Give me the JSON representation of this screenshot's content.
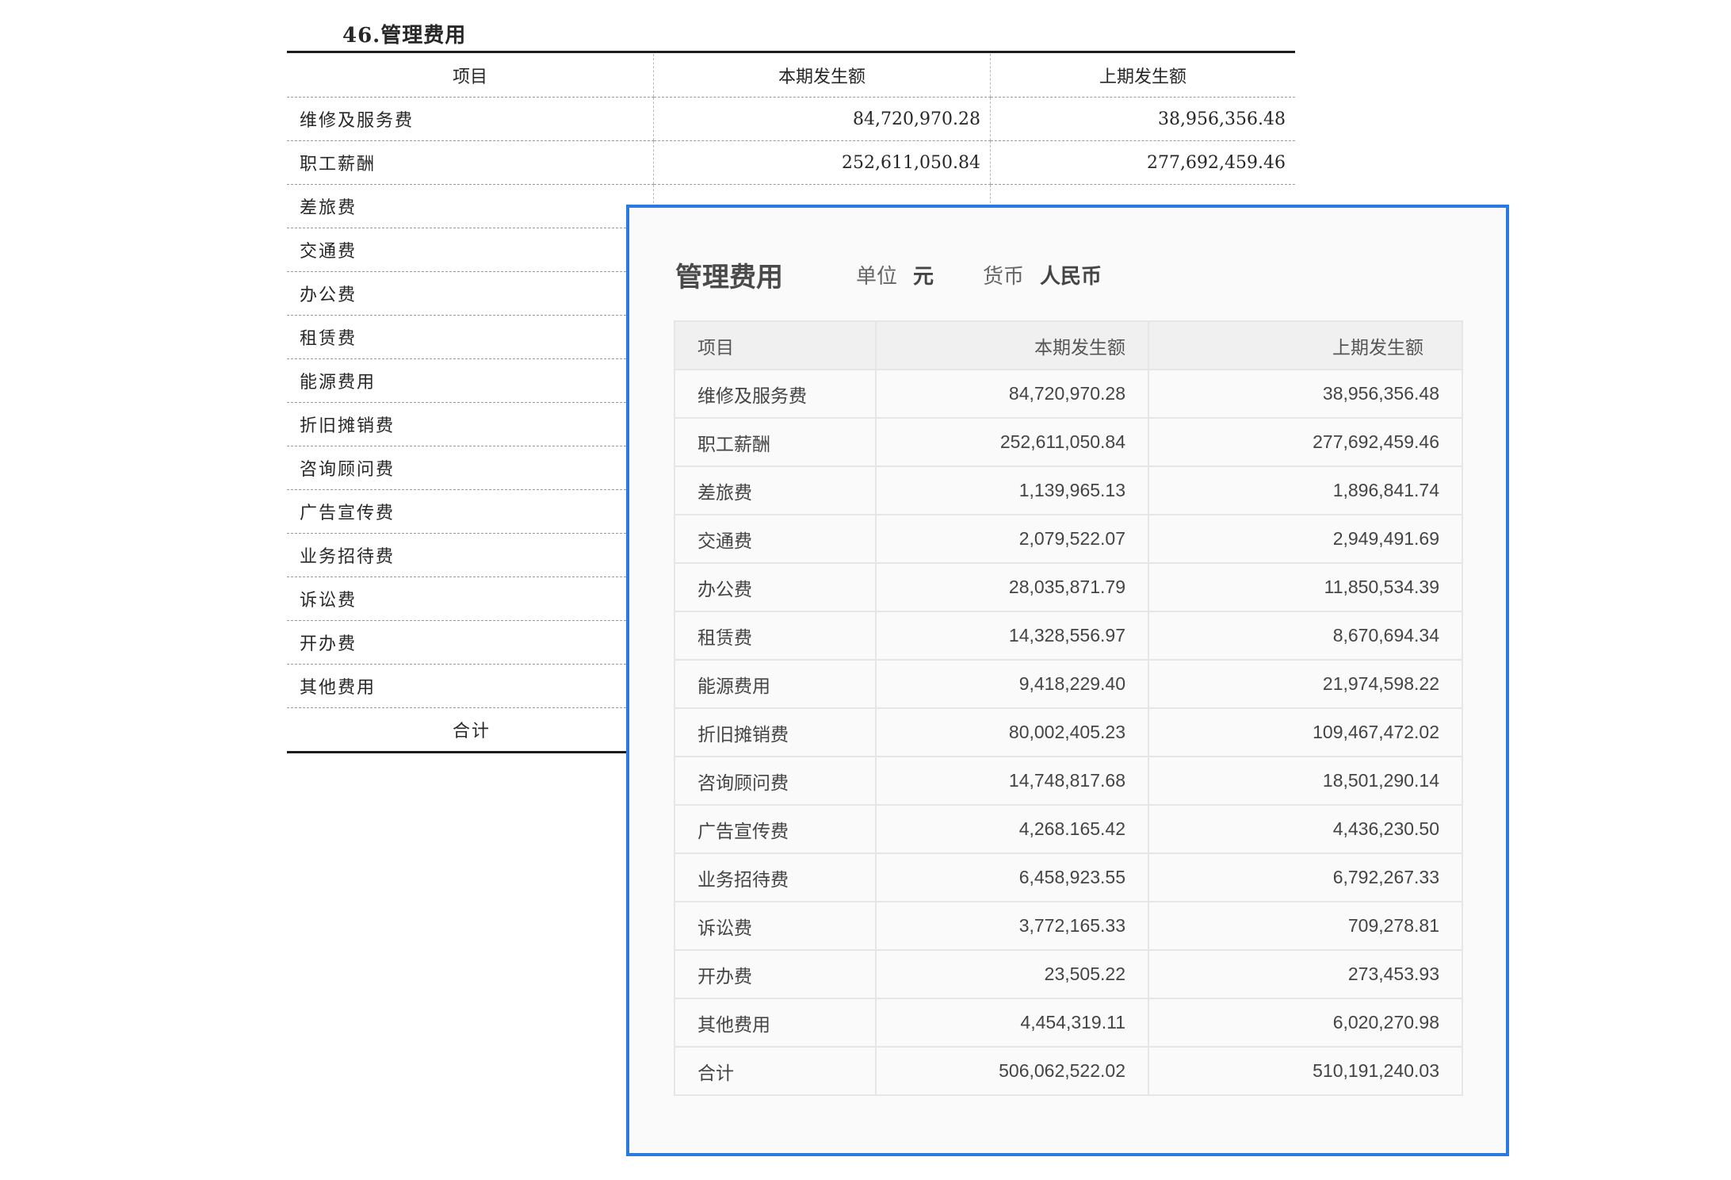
{
  "scan": {
    "title": "46.管理费用",
    "columns": [
      "项目",
      "本期发生额",
      "上期发生额"
    ],
    "rows": [
      {
        "item": "维修及服务费",
        "current": "84,720,970.28",
        "previous": "38,956,356.48"
      },
      {
        "item": "职工薪酬",
        "current": "252,611,050.84",
        "previous": "277,692,459.46"
      },
      {
        "item": "差旅费",
        "current": "",
        "previous": ""
      },
      {
        "item": "交通费",
        "current": "",
        "previous": ""
      },
      {
        "item": "办公费",
        "current": "",
        "previous": ""
      },
      {
        "item": "租赁费",
        "current": "",
        "previous": ""
      },
      {
        "item": "能源费用",
        "current": "",
        "previous": ""
      },
      {
        "item": "折旧摊销费",
        "current": "",
        "previous": ""
      },
      {
        "item": "咨询顾问费",
        "current": "",
        "previous": ""
      },
      {
        "item": "广告宣传费",
        "current": "",
        "previous": ""
      },
      {
        "item": "业务招待费",
        "current": "",
        "previous": ""
      },
      {
        "item": "诉讼费",
        "current": "",
        "previous": ""
      },
      {
        "item": "开办费",
        "current": "",
        "previous": ""
      },
      {
        "item": "其他费用",
        "current": "",
        "previous": ""
      }
    ],
    "total_label": "合计"
  },
  "card": {
    "title": "管理费用",
    "unit_label": "单位",
    "unit_value": "元",
    "currency_label": "货币",
    "currency_value": "人民币",
    "columns": [
      "项目",
      "本期发生额",
      "上期发生额"
    ],
    "rows": [
      {
        "item": "维修及服务费",
        "current": "84,720,970.28",
        "previous": "38,956,356.48"
      },
      {
        "item": "职工薪酬",
        "current": "252,611,050.84",
        "previous": "277,692,459.46"
      },
      {
        "item": "差旅费",
        "current": "1,139,965.13",
        "previous": "1,896,841.74"
      },
      {
        "item": "交通费",
        "current": "2,079,522.07",
        "previous": "2,949,491.69"
      },
      {
        "item": "办公费",
        "current": "28,035,871.79",
        "previous": "11,850,534.39"
      },
      {
        "item": "租赁费",
        "current": "14,328,556.97",
        "previous": "8,670,694.34"
      },
      {
        "item": "能源费用",
        "current": "9,418,229.40",
        "previous": "21,974,598.22"
      },
      {
        "item": "折旧摊销费",
        "current": "80,002,405.23",
        "previous": "109,467,472.02"
      },
      {
        "item": "咨询顾问费",
        "current": "14,748,817.68",
        "previous": "18,501,290.14"
      },
      {
        "item": "广告宣传费",
        "current": "4,268.165.42",
        "previous": "4,436,230.50"
      },
      {
        "item": "业务招待费",
        "current": "6,458,923.55",
        "previous": "6,792,267.33"
      },
      {
        "item": "诉讼费",
        "current": "3,772,165.33",
        "previous": "709,278.81"
      },
      {
        "item": "开办费",
        "current": "23,505.22",
        "previous": "273,453.93"
      },
      {
        "item": "其他费用",
        "current": "4,454,319.11",
        "previous": "6,020,270.98"
      },
      {
        "item": "合计",
        "current": "506,062,522.02",
        "previous": "510,191,240.03"
      }
    ]
  },
  "colors": {
    "card_border": "#2a7ae2",
    "card_background": "#fafafa",
    "header_background": "#f0f0f0"
  }
}
